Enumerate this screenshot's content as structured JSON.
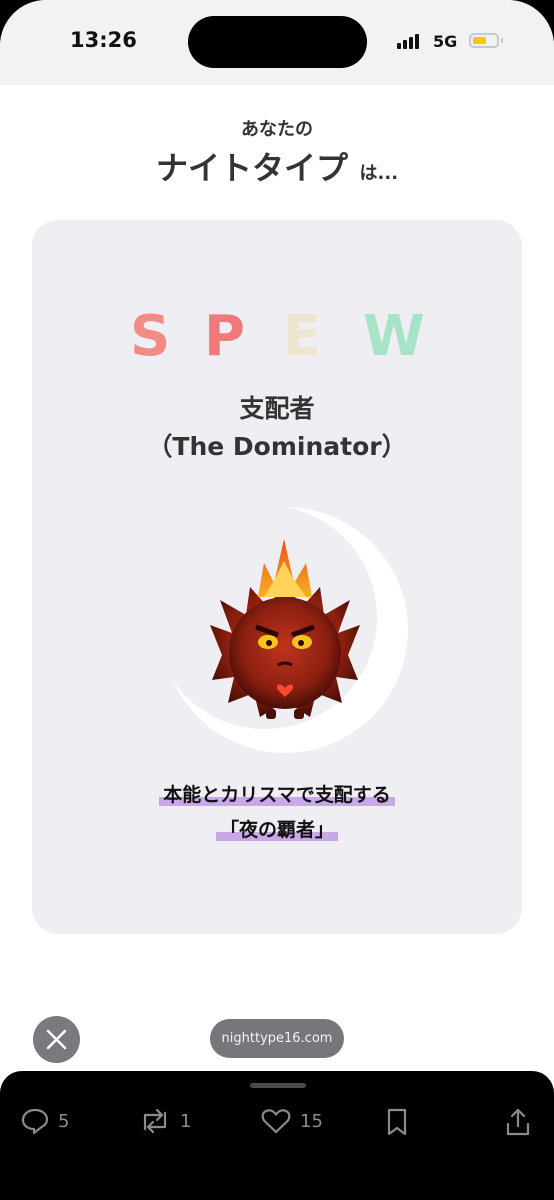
{
  "status_bar": {
    "time": "13:26",
    "network": "5G"
  },
  "page": {
    "subtitle": "あなたの",
    "title": "ナイトタイプ",
    "title_suffix": "は...",
    "card": {
      "letters": [
        {
          "char": "S",
          "color": "#f28a86"
        },
        {
          "char": "P",
          "color": "#f0797c"
        },
        {
          "char": "E",
          "color": "#ece6cf"
        },
        {
          "char": "W",
          "color": "#a7e3c6"
        }
      ],
      "type_name": "支配者",
      "type_name_en": "（The Dominator）",
      "tagline_line1": "本能とカリスマで支配する",
      "tagline_line2": "「夜の覇者」",
      "highlight_color": "#c9a8e6"
    }
  },
  "browser": {
    "url": "nighttype16.com"
  },
  "actions": {
    "replies": "5",
    "reposts": "1",
    "likes": "15"
  }
}
